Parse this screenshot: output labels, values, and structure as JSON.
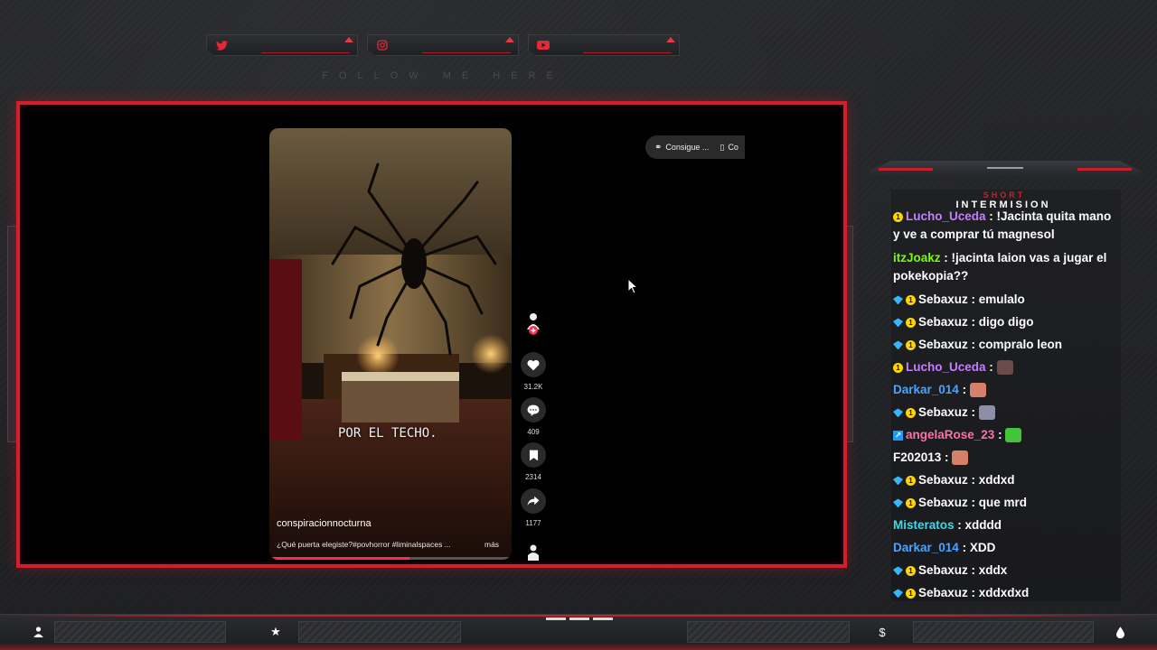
{
  "overlay": {
    "follow_text": "FOLLOW ME HERE",
    "chat_title_small": "SHORT",
    "chat_title_big": "INTERMISION",
    "accent_color": "#d21f2b"
  },
  "social": [
    {
      "icon": "twitter-icon",
      "handle": ""
    },
    {
      "icon": "instagram-icon",
      "handle": ""
    },
    {
      "icon": "youtube-icon",
      "handle": ""
    }
  ],
  "video": {
    "caption": "POR EL TECHO.",
    "username": "conspiracionnocturna",
    "description": "¿Qué puerta elegiste?#povhorror #liminalspaces ...",
    "more_label": "más",
    "top_pill_label": "Consigue ...",
    "top_pill_label_2": "Co",
    "progress": 0.58,
    "actions": [
      {
        "icon": "avatar-follow-icon",
        "count": ""
      },
      {
        "icon": "heart-icon",
        "count": "31.2K"
      },
      {
        "icon": "comment-icon",
        "count": "409"
      },
      {
        "icon": "bookmark-icon",
        "count": "2314"
      },
      {
        "icon": "share-icon",
        "count": "1177"
      },
      {
        "icon": "profile-icon",
        "count": ""
      }
    ]
  },
  "chat": {
    "messages": [
      {
        "badges": [
          "sub"
        ],
        "user": "Lucho_Uceda",
        "color": "#c77dff",
        "text": "!Jacinta quita mano y ve a comprar tú magnesol"
      },
      {
        "badges": [],
        "user": "itzJoakz",
        "color": "#7cfc00",
        "text": "!jacinta laion vas a jugar el pokekopia??"
      },
      {
        "badges": [
          "gem",
          "sub"
        ],
        "user": "Sebaxuz",
        "color": "#ffffff",
        "text": "emulalo"
      },
      {
        "badges": [
          "gem",
          "sub"
        ],
        "user": "Sebaxuz",
        "color": "#ffffff",
        "text": "digo digo"
      },
      {
        "badges": [
          "gem",
          "sub"
        ],
        "user": "Sebaxuz",
        "color": "#ffffff",
        "text": "compralo leon"
      },
      {
        "badges": [
          "sub"
        ],
        "user": "Lucho_Uceda",
        "color": "#c77dff",
        "text": "",
        "emote": "#6b4a4a"
      },
      {
        "badges": [],
        "user": "Darkar_014",
        "color": "#4aa3ff",
        "text": "",
        "emote": "#d6806a"
      },
      {
        "badges": [
          "gem",
          "sub"
        ],
        "user": "Sebaxuz",
        "color": "#ffffff",
        "text": "",
        "emote": "#8e8ea8"
      },
      {
        "badges": [
          "pred"
        ],
        "user": "angelaRose_23",
        "color": "#ff6fa8",
        "text": "",
        "emote": "#45c43b"
      },
      {
        "badges": [],
        "user": "F202013",
        "color": "#ffffff",
        "text": "",
        "emote": "#d6806a"
      },
      {
        "badges": [
          "gem",
          "sub"
        ],
        "user": "Sebaxuz",
        "color": "#ffffff",
        "text": "xddxd"
      },
      {
        "badges": [
          "gem",
          "sub"
        ],
        "user": "Sebaxuz",
        "color": "#ffffff",
        "text": "que mrd"
      },
      {
        "badges": [],
        "user": "Misteratos",
        "color": "#3cdbe8",
        "text": "xdddd"
      },
      {
        "badges": [],
        "user": "Darkar_014",
        "color": "#4aa3ff",
        "text": "XDD"
      },
      {
        "badges": [
          "gem",
          "sub"
        ],
        "user": "Sebaxuz",
        "color": "#ffffff",
        "text": "xddx"
      },
      {
        "badges": [
          "gem",
          "sub"
        ],
        "user": "Sebaxuz",
        "color": "#ffffff",
        "text": "xddxdxd"
      }
    ]
  },
  "bottom_bar": {
    "icons": [
      "user-icon",
      "star-icon",
      "dollar-icon",
      "drop-icon"
    ]
  }
}
